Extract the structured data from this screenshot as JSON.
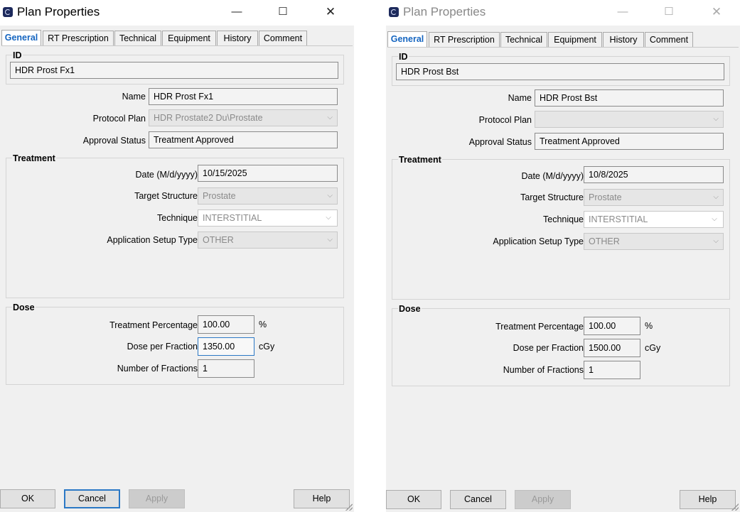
{
  "dialogs": [
    {
      "title": "Plan Properties",
      "tabs": [
        "General",
        "RT Prescription",
        "Technical",
        "Equipment",
        "History",
        "Comment"
      ],
      "active_tab": "General",
      "id_group": {
        "label": "ID",
        "value": "HDR Prost Fx1"
      },
      "name": {
        "label": "Name",
        "value": "HDR Prost Fx1"
      },
      "protocol_plan": {
        "label": "Protocol Plan",
        "value": "HDR Prostate2 Du\\Prostate"
      },
      "approval_status": {
        "label": "Approval Status",
        "value": "Treatment Approved"
      },
      "treatment": {
        "title": "Treatment",
        "date": {
          "label": "Date (M/d/yyyy)",
          "value": "10/15/2025"
        },
        "target_structure": {
          "label": "Target Structure",
          "value": "Prostate"
        },
        "technique": {
          "label": "Technique",
          "value": "INTERSTITIAL"
        },
        "application_setup_type": {
          "label": "Application Setup Type",
          "value": "OTHER"
        }
      },
      "dose": {
        "title": "Dose",
        "treatment_percentage": {
          "label": "Treatment Percentage",
          "value": "100.00",
          "unit": "%"
        },
        "dose_per_fraction": {
          "label": "Dose per Fraction",
          "value": "1350.00",
          "unit": "cGy"
        },
        "number_of_fractions": {
          "label": "Number of Fractions",
          "value": "1"
        }
      },
      "buttons": {
        "ok": "OK",
        "cancel": "Cancel",
        "apply": "Apply",
        "help": "Help"
      }
    },
    {
      "title": "Plan Properties",
      "tabs": [
        "General",
        "RT Prescription",
        "Technical",
        "Equipment",
        "History",
        "Comment"
      ],
      "active_tab": "General",
      "id_group": {
        "label": "ID",
        "value": "HDR Prost Bst"
      },
      "name": {
        "label": "Name",
        "value": "HDR Prost Bst"
      },
      "protocol_plan": {
        "label": "Protocol Plan",
        "value": ""
      },
      "approval_status": {
        "label": "Approval Status",
        "value": "Treatment Approved"
      },
      "treatment": {
        "title": "Treatment",
        "date": {
          "label": "Date (M/d/yyyy)",
          "value": "10/8/2025"
        },
        "target_structure": {
          "label": "Target Structure",
          "value": "Prostate"
        },
        "technique": {
          "label": "Technique",
          "value": "INTERSTITIAL"
        },
        "application_setup_type": {
          "label": "Application Setup Type",
          "value": "OTHER"
        }
      },
      "dose": {
        "title": "Dose",
        "treatment_percentage": {
          "label": "Treatment Percentage",
          "value": "100.00",
          "unit": "%"
        },
        "dose_per_fraction": {
          "label": "Dose per Fraction",
          "value": "1500.00",
          "unit": "cGy"
        },
        "number_of_fractions": {
          "label": "Number of Fractions",
          "value": "1"
        }
      },
      "buttons": {
        "ok": "OK",
        "cancel": "Cancel",
        "apply": "Apply",
        "help": "Help"
      }
    }
  ],
  "icons": {
    "window_minimize": "minimize-icon",
    "window_maximize": "maximize-icon",
    "window_close": "close-icon",
    "dropdown": "chevron-down-icon"
  },
  "colors": {
    "active_tab_text": "#1565c0",
    "focus_border": "#2b78c5",
    "window_bg": "#f0f0f0"
  }
}
